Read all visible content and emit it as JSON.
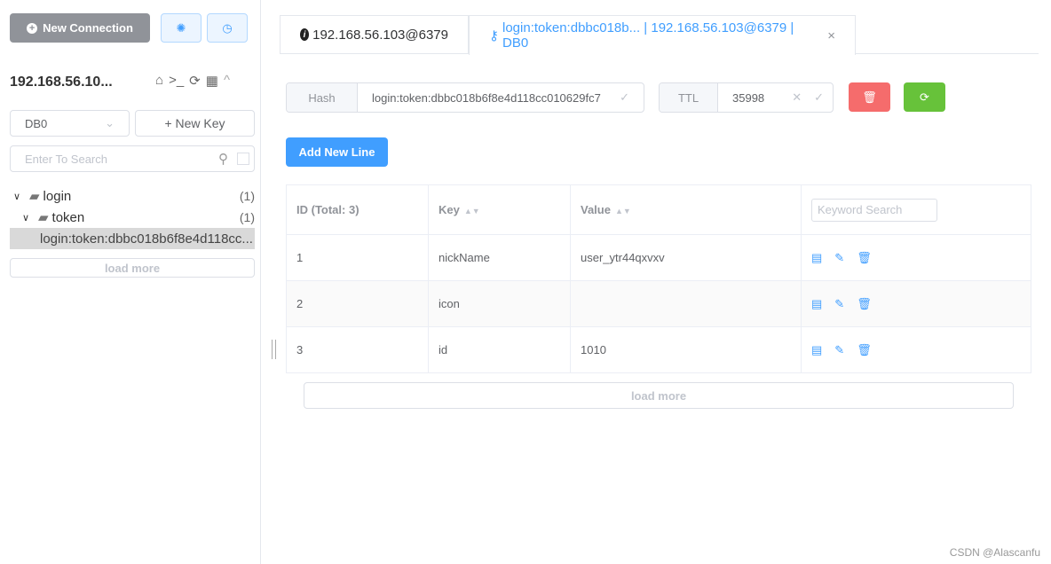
{
  "sidebar": {
    "new_connection": "New Connection",
    "connection_name": "192.168.56.10...",
    "db_select": "DB0",
    "new_key": "+ New Key",
    "search_placeholder": "Enter To Search",
    "tree": [
      {
        "label": "login",
        "count": "(1)"
      },
      {
        "label": "token",
        "count": "(1)"
      },
      {
        "label": "login:token:dbbc018b6f8e4d118cc..."
      }
    ],
    "load_more": "load more"
  },
  "tabs": [
    {
      "label": "192.168.56.103@6379",
      "icon": "info-icon"
    },
    {
      "label": "login:token:dbbc018b... | 192.168.56.103@6379 | DB0",
      "icon": "key-icon",
      "close": "×"
    }
  ],
  "key": {
    "type": "Hash",
    "name": "login:token:dbbc018b6f8e4d118cc010629fc7",
    "ttl_label": "TTL",
    "ttl": "35998"
  },
  "add_line": "Add New Line",
  "table": {
    "headers": [
      "ID (Total: 3)",
      "Key",
      "Value"
    ],
    "keyword_placeholder": "Keyword Search",
    "rows": [
      {
        "id": "1",
        "key": "nickName",
        "value": "user_ytr44qxvxv"
      },
      {
        "id": "2",
        "key": "icon",
        "value": ""
      },
      {
        "id": "3",
        "key": "id",
        "value": "1010"
      }
    ]
  },
  "main_load_more": "load more",
  "watermark": "CSDN @Alascanfu",
  "colors": {
    "primary": "#409eff",
    "danger": "#f56c6c",
    "success": "#67c23a",
    "gray_button": "#909399"
  }
}
